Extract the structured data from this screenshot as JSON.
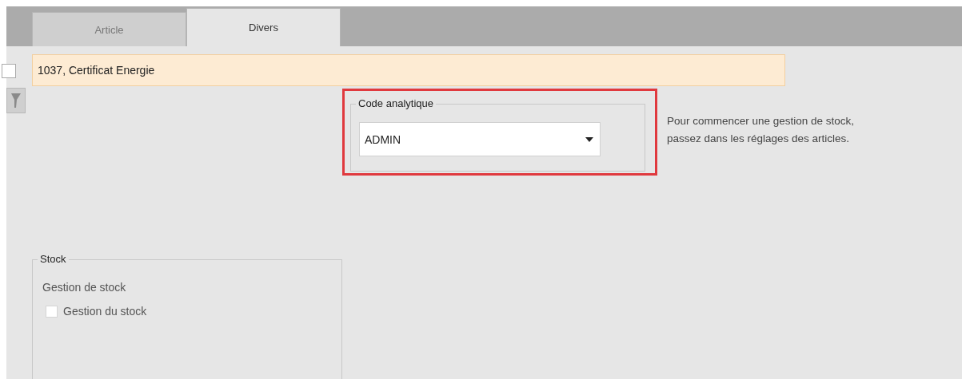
{
  "tabs": [
    {
      "label": "Article",
      "selected": false
    },
    {
      "label": "Divers",
      "selected": true
    }
  ],
  "record": {
    "checked": false,
    "label": "1037, Certificat Energie"
  },
  "code_analytique": {
    "legend": "Code analytique",
    "value": "ADMIN",
    "highlighted": true
  },
  "info": "Pour commencer une gestion de stock, passez dans les réglages des articles.",
  "stock": {
    "legend": "Stock",
    "heading": "Gestion de stock",
    "checkbox": {
      "label": "Gestion du stock",
      "checked": false
    }
  }
}
